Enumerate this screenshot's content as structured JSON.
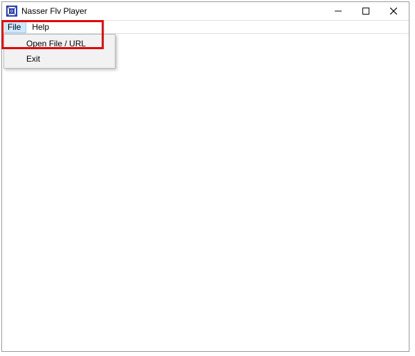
{
  "window": {
    "title": "Nasser Flv Player"
  },
  "menubar": {
    "items": [
      {
        "label": "File",
        "active": true
      },
      {
        "label": "Help",
        "active": false
      }
    ]
  },
  "dropdown": {
    "items": [
      {
        "label": "Open File / URL"
      },
      {
        "label": "Exit"
      }
    ]
  },
  "icons": {
    "app": "app-icon",
    "minimize": "minimize-icon",
    "maximize": "maximize-icon",
    "close": "close-icon"
  }
}
